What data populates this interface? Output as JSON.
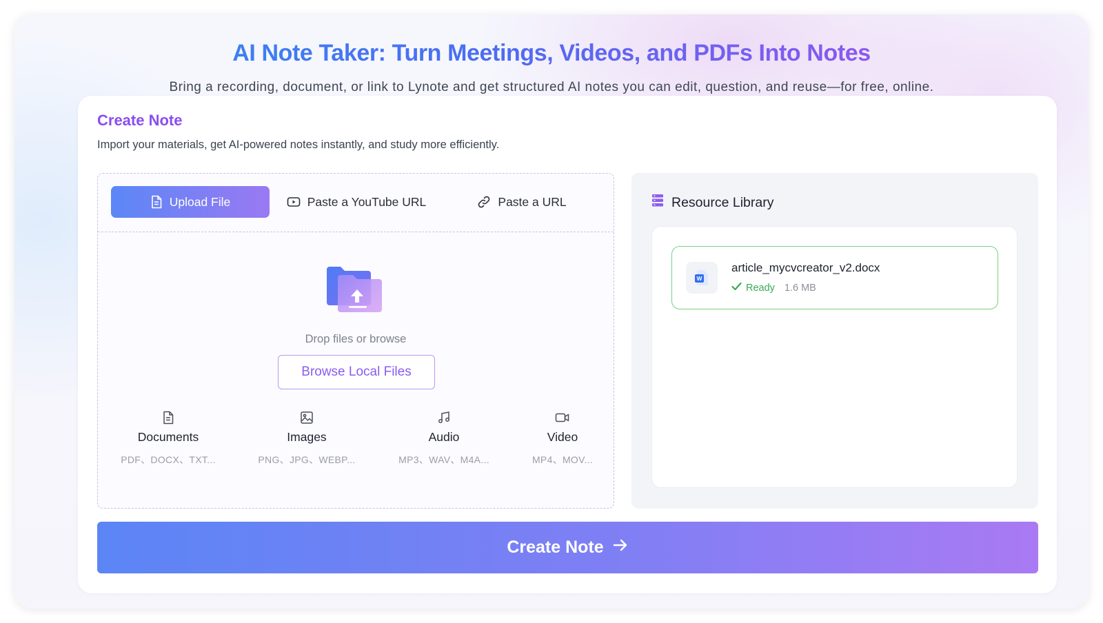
{
  "hero": {
    "title": "AI Note Taker: Turn Meetings, Videos, and PDFs Into Notes",
    "subtitle": "Bring a recording, document, or link to Lynote and get structured AI notes you can edit, question, and reuse—for free, online."
  },
  "create_note": {
    "title": "Create Note",
    "description": "Import your materials, get AI-powered notes instantly, and study more efficiently."
  },
  "tabs": [
    {
      "label": "Upload File",
      "icon": "file-icon",
      "active": true
    },
    {
      "label": "Paste a YouTube URL",
      "icon": "youtube-icon",
      "active": false
    },
    {
      "label": "Paste a URL",
      "icon": "link-icon",
      "active": false
    }
  ],
  "upload": {
    "drop_text": "Drop files or browse",
    "browse_label": "Browse Local Files"
  },
  "file_types": [
    {
      "name": "Documents",
      "extensions": "PDF、DOCX、TXT...",
      "icon": "document-icon"
    },
    {
      "name": "Images",
      "extensions": "PNG、JPG、WEBP...",
      "icon": "image-icon"
    },
    {
      "name": "Audio",
      "extensions": "MP3、WAV、M4A...",
      "icon": "music-icon"
    },
    {
      "name": "Video",
      "extensions": "MP4、MOV...",
      "icon": "video-icon"
    }
  ],
  "library": {
    "title": "Resource Library",
    "files": [
      {
        "name": "article_mycvcreator_v2.docx",
        "status": "Ready",
        "size": "1.6 MB",
        "icon": "word-doc-icon"
      }
    ]
  },
  "submit": {
    "label": "Create Note"
  },
  "colors": {
    "accent_purple": "#8a4df0",
    "accent_blue": "#5b87f6",
    "ready_green": "#3aa953"
  }
}
